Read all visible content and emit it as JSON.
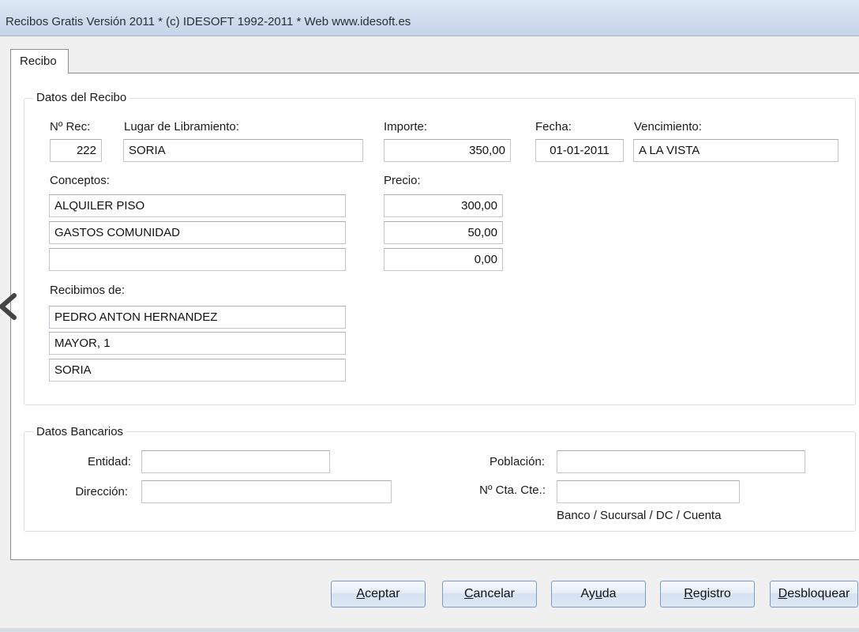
{
  "window": {
    "title": "Recibos Gratis  Versión 2011  * (c) IDESOFT 1992-2011  * Web www.idesoft.es"
  },
  "tabs": [
    {
      "label": "Recibo",
      "active": true
    }
  ],
  "datos_recibo": {
    "group_title": "Datos del Recibo",
    "labels": {
      "num_rec": "Nº Rec:",
      "lugar": "Lugar de Libramiento:",
      "importe": "Importe:",
      "fecha": "Fecha:",
      "vencimiento": "Vencimiento:",
      "conceptos": "Conceptos:",
      "precio": "Precio:",
      "recibimos": "Recibimos de:"
    },
    "values": {
      "num_rec": "222",
      "lugar": "SORIA",
      "importe": "350,00",
      "fecha": "01-01-2011",
      "vencimiento": "A LA VISTA"
    },
    "conceptos": [
      {
        "concepto": "ALQUILER PISO",
        "precio": "300,00"
      },
      {
        "concepto": "GASTOS COMUNIDAD",
        "precio": "50,00"
      },
      {
        "concepto": "",
        "precio": "0,00"
      }
    ],
    "recibimos_de": [
      "PEDRO ANTON HERNANDEZ",
      "MAYOR, 1",
      "SORIA"
    ]
  },
  "datos_bancarios": {
    "group_title": "Datos Bancarios",
    "labels": {
      "entidad": "Entidad:",
      "direccion": "Dirección:",
      "poblacion": "Población:",
      "cuenta": "Nº Cta. Cte.:",
      "cuenta_hint": "Banco / Sucursal / DC / Cuenta"
    },
    "values": {
      "entidad": "",
      "direccion": "",
      "poblacion": "",
      "cuenta": ""
    }
  },
  "buttons": {
    "aceptar": {
      "accel": "A",
      "rest": "ceptar"
    },
    "cancelar": {
      "accel": "C",
      "rest": "ancelar"
    },
    "ayuda": {
      "pre": "Ay",
      "accel": "u",
      "rest": "da"
    },
    "registro": {
      "accel": "R",
      "rest": "egistro"
    },
    "desbloquear": {
      "accel": "D",
      "rest": "esbloquear"
    }
  },
  "icons": {
    "back": "chevron-left-icon"
  },
  "colors": {
    "titlebar": "#cfdcec",
    "panel": "#ffffff",
    "button_border": "#7a9ac2"
  }
}
